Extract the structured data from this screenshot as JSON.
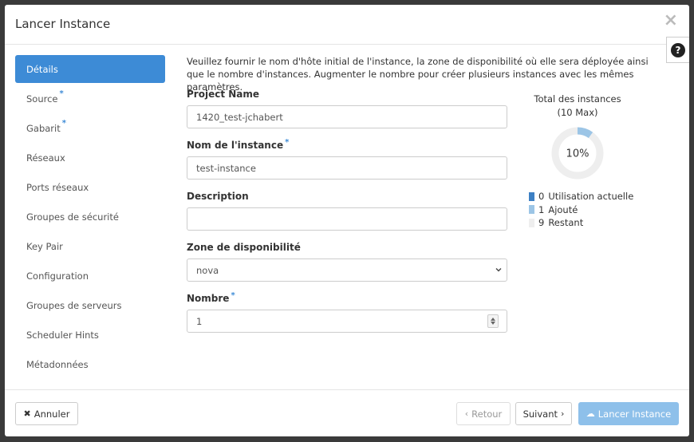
{
  "modal": {
    "title": "Lancer Instance",
    "close_glyph": "×",
    "help_glyph": "?"
  },
  "sidebar": {
    "items": [
      {
        "label": "Détails",
        "required": false,
        "active": true
      },
      {
        "label": "Source",
        "required": true,
        "active": false
      },
      {
        "label": "Gabarit",
        "required": true,
        "active": false
      },
      {
        "label": "Réseaux",
        "required": false,
        "active": false
      },
      {
        "label": "Ports réseaux",
        "required": false,
        "active": false
      },
      {
        "label": "Groupes de sécurité",
        "required": false,
        "active": false
      },
      {
        "label": "Key Pair",
        "required": false,
        "active": false
      },
      {
        "label": "Configuration",
        "required": false,
        "active": false
      },
      {
        "label": "Groupes de serveurs",
        "required": false,
        "active": false
      },
      {
        "label": "Scheduler Hints",
        "required": false,
        "active": false
      },
      {
        "label": "Métadonnées",
        "required": false,
        "active": false
      }
    ]
  },
  "details": {
    "intro": "Veuillez fournir le nom d'hôte initial de l'instance, la zone de disponibilité où elle sera déployée ainsi que le nombre d'instances. Augmenter le nombre pour créer plusieurs instances avec les mêmes paramètres.",
    "project_name": {
      "label": "Project Name",
      "value": "1420_test-jchabert"
    },
    "instance_name": {
      "label": "Nom de l'instance",
      "value": "test-instance"
    },
    "description": {
      "label": "Description",
      "value": ""
    },
    "zone": {
      "label": "Zone de disponibilité",
      "value": "nova"
    },
    "count": {
      "label": "Nombre",
      "value": "1"
    },
    "required_marker": "*"
  },
  "quota": {
    "title_line1": "Total des instances",
    "title_line2": "(10 Max)",
    "percent_label": "10%",
    "used_fraction": 0.0,
    "added_fraction": 0.1,
    "legend": [
      {
        "value": "0",
        "label": "Utilisation actuelle",
        "color": "#3d80c4"
      },
      {
        "value": "1",
        "label": "Ajouté",
        "color": "#9cc5e6"
      },
      {
        "value": "9",
        "label": "Restant",
        "color": "#eeeeee"
      }
    ],
    "ring_color": "#eeeeee",
    "added_color": "#9cc5e6"
  },
  "footer": {
    "cancel_label": "Annuler",
    "back_label": "Retour",
    "next_label": "Suivant",
    "launch_label": "Lancer Instance"
  },
  "colors": {
    "accent": "#3d8bd6",
    "launch_disabled": "#8ec0ea"
  }
}
